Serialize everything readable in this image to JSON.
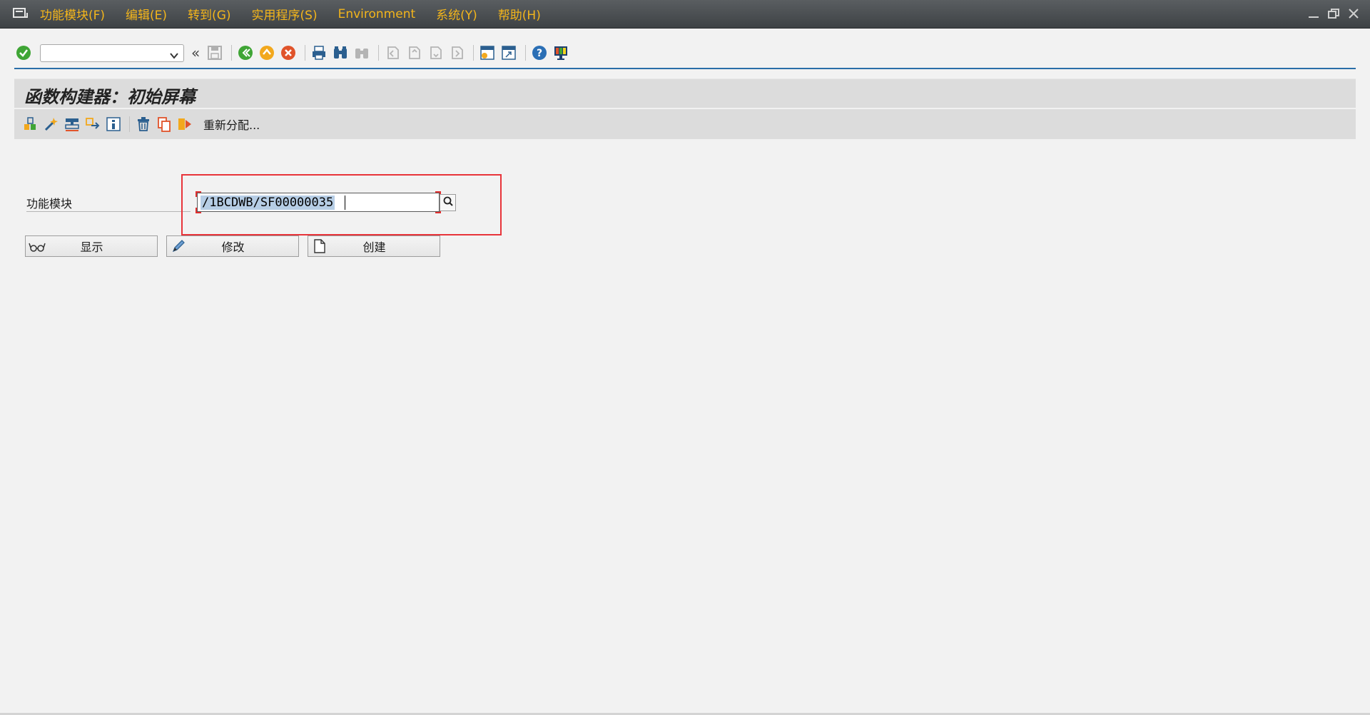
{
  "menu": {
    "items": [
      "功能模块(F)",
      "编辑(E)",
      "转到(G)",
      "实用程序(S)",
      "Environment",
      "系统(Y)",
      "帮助(H)"
    ]
  },
  "screen": {
    "title": "函数构建器：初始屏幕"
  },
  "app_toolbar": {
    "reassign_label": "重新分配..."
  },
  "form": {
    "field_label": "功能模块",
    "field_value": "/1BCDWB/SF00000035"
  },
  "buttons": {
    "display": "显示",
    "change": "修改",
    "create": "创建"
  },
  "colors": {
    "menu_text": "#f3b51b",
    "accent_line": "#2a6ea8",
    "highlight_box": "#e8343a",
    "selection": "#b6cde5"
  }
}
